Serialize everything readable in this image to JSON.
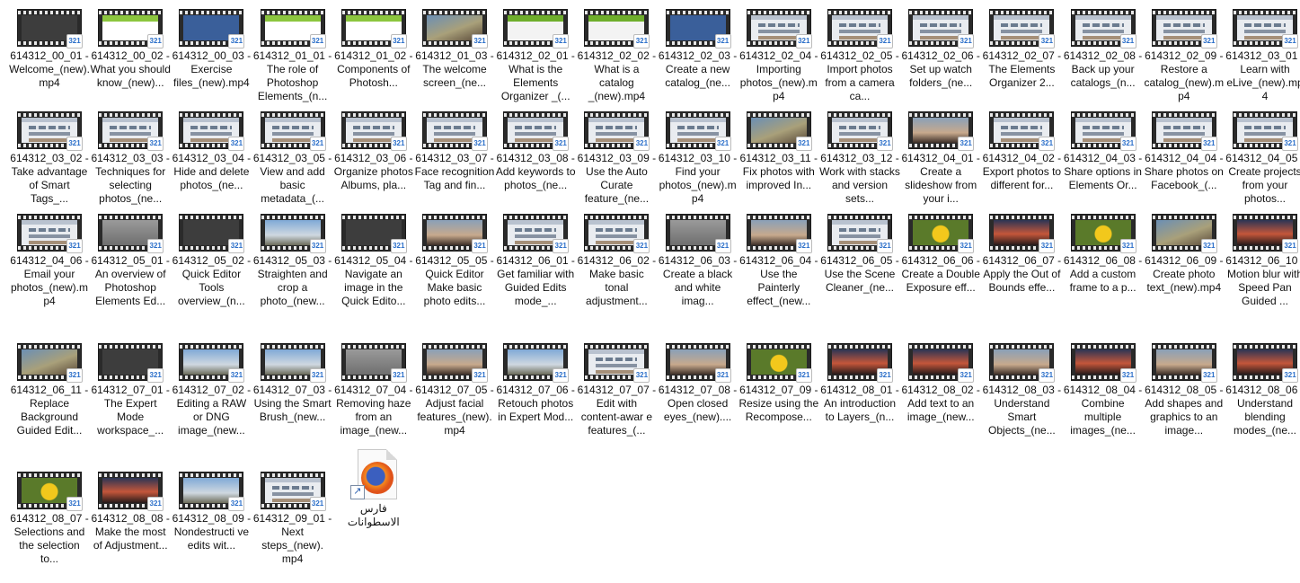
{
  "files": [
    {
      "label": "614312_00_01 - Welcome_(new).mp4",
      "thumb": "dark"
    },
    {
      "label": "614312_00_02 - What you should know_(new)...",
      "thumb": "green"
    },
    {
      "label": "614312_00_03 - Exercise files_(new).mp4",
      "thumb": "blue"
    },
    {
      "label": "614312_01_01 - The role of Photoshop Elements_(n...",
      "thumb": "green"
    },
    {
      "label": "614312_01_02 - Components of Photosh...",
      "thumb": "green"
    },
    {
      "label": "614312_01_03 - The welcome screen_(ne...",
      "thumb": "photo"
    },
    {
      "label": "614312_02_01 - What is the Elements Organizer _(...",
      "thumb": "green2"
    },
    {
      "label": "614312_02_02 - What is a catalog _(new).mp4",
      "thumb": "green2"
    },
    {
      "label": "614312_02_03 - Create a new catalog_(ne...",
      "thumb": "blue"
    },
    {
      "label": "614312_02_04 - Importing photos_(new).mp4",
      "thumb": "ui"
    },
    {
      "label": "614312_02_05 - Import photos from a camera ca...",
      "thumb": "ui"
    },
    {
      "label": "614312_02_06 - Set up watch folders_(ne...",
      "thumb": "ui"
    },
    {
      "label": "614312_02_07 - The Elements Organizer 2...",
      "thumb": "ui"
    },
    {
      "label": "614312_02_08 - Back up your catalogs_(n...",
      "thumb": "ui"
    },
    {
      "label": "614312_02_09 - Restore a catalog_(new).mp4",
      "thumb": "ui"
    },
    {
      "label": "614312_03_01 - Learn with eLive_(new).mp4",
      "thumb": "ui"
    },
    {
      "label": "614312_03_02 - Take advantage of Smart Tags_...",
      "thumb": "ui"
    },
    {
      "label": "614312_03_03 - Techniques for selecting photos_(ne...",
      "thumb": "ui"
    },
    {
      "label": "614312_03_04 - Hide and delete photos_(ne...",
      "thumb": "ui"
    },
    {
      "label": "614312_03_05 - View and add basic metadata_(...",
      "thumb": "ui"
    },
    {
      "label": "614312_03_06 - Organize photos Albums, pla...",
      "thumb": "ui"
    },
    {
      "label": "614312_03_07 - Face recognition Tag and fin...",
      "thumb": "ui"
    },
    {
      "label": "614312_03_08 - Add keywords to photos_(ne...",
      "thumb": "ui"
    },
    {
      "label": "614312_03_09 - Use the Auto Curate feature_(ne...",
      "thumb": "ui"
    },
    {
      "label": "614312_03_10 - Find your photos_(new).mp4",
      "thumb": "ui"
    },
    {
      "label": "614312_03_11 - Fix photos with improved In...",
      "thumb": "photo"
    },
    {
      "label": "614312_03_12 - Work with stacks and version sets...",
      "thumb": "ui"
    },
    {
      "label": "614312_04_01 - Create a slideshow from your i...",
      "thumb": "person"
    },
    {
      "label": "614312_04_02 - Export photos to different for...",
      "thumb": "ui"
    },
    {
      "label": "614312_04_03 - Share options in Elements Or...",
      "thumb": "ui"
    },
    {
      "label": "614312_04_04 - Share photos on Facebook_(...",
      "thumb": "ui"
    },
    {
      "label": "614312_04_05 - Create projects from your photos...",
      "thumb": "ui"
    },
    {
      "label": "614312_04_06 - Email your photos_(new).mp4",
      "thumb": "ui"
    },
    {
      "label": "614312_05_01 - An overview of Photoshop Elements Ed...",
      "thumb": "gray"
    },
    {
      "label": "614312_05_02 - Quick Editor Tools overview_(n...",
      "thumb": "dark"
    },
    {
      "label": "614312_05_03 - Straighten and crop a photo_(new...",
      "thumb": "sky"
    },
    {
      "label": "614312_05_04 - Navigate an image in the Quick Edito...",
      "thumb": "dark"
    },
    {
      "label": "614312_05_05 - Quick Editor Make basic photo edits...",
      "thumb": "person"
    },
    {
      "label": "614312_06_01 - Get familiar with Guided Edits mode_...",
      "thumb": "ui"
    },
    {
      "label": "614312_06_02 - Make basic tonal adjustment...",
      "thumb": "ui"
    },
    {
      "label": "614312_06_03 - Create a black and white imag...",
      "thumb": "gray"
    },
    {
      "label": "614312_06_04 - Use the Painterly effect_(new...",
      "thumb": "person"
    },
    {
      "label": "614312_06_05 - Use the Scene Cleaner_(ne...",
      "thumb": "ui"
    },
    {
      "label": "614312_06_06 - Create a Double Exposure eff...",
      "thumb": "flower"
    },
    {
      "label": "614312_06_07 - Apply the Out of Bounds effe...",
      "thumb": "sunset"
    },
    {
      "label": "614312_06_08 - Add a custom frame to a p...",
      "thumb": "flower"
    },
    {
      "label": "614312_06_09 - Create photo text_(new).mp4",
      "thumb": "photo"
    },
    {
      "label": "614312_06_10 - Motion blur with Speed Pan Guided ...",
      "thumb": "sunset"
    },
    {
      "label": "614312_06_11 - Replace Background Guided Edit...",
      "thumb": "photo"
    },
    {
      "label": "614312_07_01 - The Expert Mode workspace_...",
      "thumb": "dark"
    },
    {
      "label": "614312_07_02 - Editing a RAW or DNG image_(new...",
      "thumb": "sky"
    },
    {
      "label": "614312_07_03 - Using the Smart Brush_(new...",
      "thumb": "sky"
    },
    {
      "label": "614312_07_04 - Removing haze from an image_(new...",
      "thumb": "gray"
    },
    {
      "label": "614312_07_05 - Adjust facial features_(new).mp4",
      "thumb": "person"
    },
    {
      "label": "614312_07_06 - Retouch photos in Expert Mod...",
      "thumb": "sky"
    },
    {
      "label": "614312_07_07 - Edit with content-awar e features_(...",
      "thumb": "ui"
    },
    {
      "label": "614312_07_08 - Open closed eyes_(new)....",
      "thumb": "person"
    },
    {
      "label": "614312_07_09 - Resize using the Recompose...",
      "thumb": "flower"
    },
    {
      "label": "614312_08_01 - An introduction to Layers_(n...",
      "thumb": "sunset"
    },
    {
      "label": "614312_08_02 - Add text to an image_(new...",
      "thumb": "sunset"
    },
    {
      "label": "614312_08_03 - Understand Smart Objects_(ne...",
      "thumb": "person"
    },
    {
      "label": "614312_08_04 - Combine multiple images_(ne...",
      "thumb": "sunset"
    },
    {
      "label": "614312_08_05 - Add shapes and graphics to an image...",
      "thumb": "person"
    },
    {
      "label": "614312_08_06 - Understand blending modes_(ne...",
      "thumb": "sunset"
    },
    {
      "label": "614312_08_07 - Selections and the selection to...",
      "thumb": "flower"
    },
    {
      "label": "614312_08_08 - Make the most of Adjustment...",
      "thumb": "sunset"
    },
    {
      "label": "614312_08_09 - Nondestructi ve edits wit...",
      "thumb": "sky"
    },
    {
      "label": "614312_09_01 - Next steps_(new). mp4",
      "thumb": "ui"
    }
  ],
  "shortcut": {
    "label": "فارس الاسطوانات",
    "icon": "firefox-icon"
  },
  "badge_text": "321"
}
